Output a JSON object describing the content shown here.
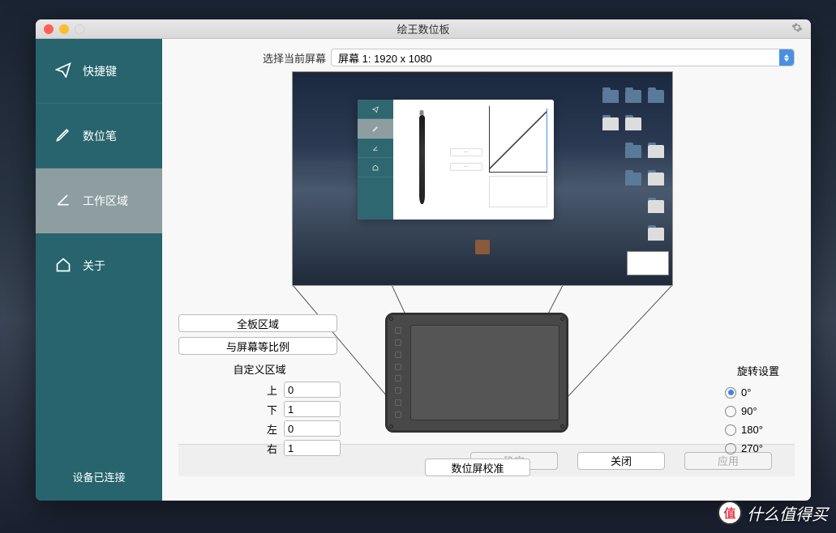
{
  "window_title": "绘王数位板",
  "sidebar": {
    "items": [
      {
        "label": "快捷键"
      },
      {
        "label": "数位笔"
      },
      {
        "label": "工作区域"
      },
      {
        "label": "关于"
      }
    ],
    "status": "设备已连接"
  },
  "screen": {
    "label": "选择当前屏幕",
    "selected": "屏幕 1: 1920 x 1080"
  },
  "buttons": {
    "full_area": "全板区域",
    "screen_ratio": "与屏幕等比例",
    "calibrate": "数位屏校准"
  },
  "custom_area": {
    "title": "自定义区域",
    "top_label": "上",
    "top": "0",
    "bottom_label": "下",
    "bottom": "1",
    "left_label": "左",
    "left": "0",
    "right_label": "右",
    "right": "1"
  },
  "rotation": {
    "title": "旋转设置",
    "options": [
      "0°",
      "90°",
      "180°",
      "270°"
    ],
    "selected": "0°"
  },
  "footer": {
    "ok": "确定",
    "close": "关闭",
    "apply": "应用"
  },
  "watermark": {
    "badge": "值",
    "text": "什么值得买"
  }
}
